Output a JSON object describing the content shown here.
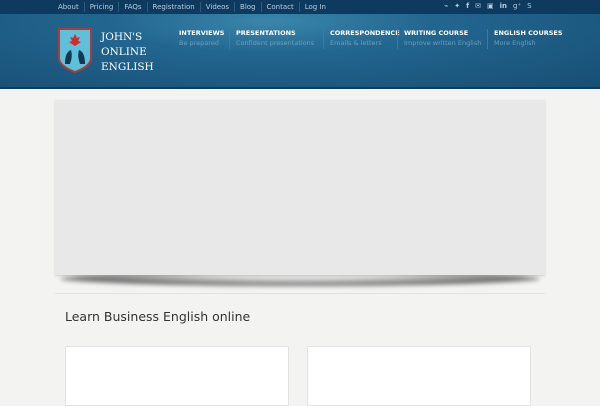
{
  "topbar": {
    "links": [
      "About",
      "Pricing",
      "FAQs",
      "Registration",
      "Videos",
      "Blog",
      "Contact",
      "Log In"
    ],
    "social_icons": [
      "rss-icon",
      "twitter-icon",
      "facebook-icon",
      "email-icon",
      "youtube-icon",
      "linkedin-icon",
      "google-plus-icon",
      "skype-icon"
    ]
  },
  "logo": {
    "line1": "JOHN'S",
    "line2": "ONLINE",
    "line3": "ENGLISH"
  },
  "nav": [
    {
      "title": "INTERVIEWS",
      "sub": "Be prepared"
    },
    {
      "title": "PRESENTATIONS",
      "sub": "Confident presentations"
    },
    {
      "title": "CORRESPONDENCE",
      "sub": "Emails & letters"
    },
    {
      "title": "WRITING COURSE",
      "sub": "Improve written English"
    },
    {
      "title": "ENGLISH COURSES",
      "sub": "More English"
    }
  ],
  "main": {
    "title": "Learn Business English online"
  }
}
